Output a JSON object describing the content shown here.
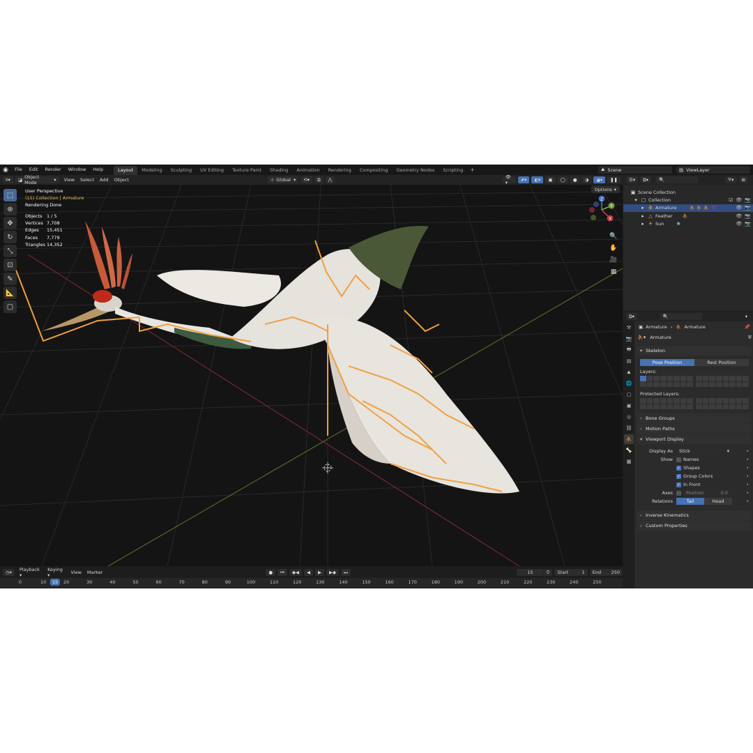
{
  "menu": {
    "items": [
      "File",
      "Edit",
      "Render",
      "Window",
      "Help"
    ],
    "workspaces": [
      "Layout",
      "Modeling",
      "Sculpting",
      "UV Editing",
      "Texture Paint",
      "Shading",
      "Animation",
      "Rendering",
      "Compositing",
      "Geometry Nodes",
      "Scripting"
    ],
    "active_workspace": "Layout",
    "scene": "Scene",
    "view_layer": "ViewLayer"
  },
  "viewport_header": {
    "mode": "Object Mode",
    "menus": [
      "View",
      "Select",
      "Add",
      "Object"
    ],
    "orientation": "Global",
    "options_label": "Options"
  },
  "overlay": {
    "view_name": "User Perspective",
    "collection_line": "(15) Collection | Armature",
    "status": "Rendering Done",
    "stats": [
      {
        "k": "Objects",
        "v": "1 / 5"
      },
      {
        "k": "Vertices",
        "v": "7,708"
      },
      {
        "k": "Edges",
        "v": "15,451"
      },
      {
        "k": "Faces",
        "v": "7,779"
      },
      {
        "k": "Triangles",
        "v": "14,352"
      }
    ],
    "gizmo_axes": {
      "x": "X",
      "y": "Y",
      "z": "Z"
    }
  },
  "timeline": {
    "menus": [
      "Playback",
      "Keying",
      "View",
      "Marker"
    ],
    "current_frame": "15",
    "start_label": "Start",
    "start": "1",
    "end_label": "End",
    "end": "250",
    "ticks": [
      "0",
      "10",
      "20",
      "30",
      "40",
      "50",
      "60",
      "70",
      "80",
      "90",
      "100",
      "110",
      "120",
      "130",
      "140",
      "150",
      "160",
      "170",
      "180",
      "190",
      "200",
      "210",
      "220",
      "230",
      "240",
      "250"
    ]
  },
  "outliner": {
    "root": "Scene Collection",
    "collection": "Collection",
    "items": [
      {
        "name": "Armature",
        "selected": true
      },
      {
        "name": "Feather",
        "selected": false
      },
      {
        "name": "Sun",
        "selected": false
      }
    ]
  },
  "properties": {
    "breadcrumb_object": "Armature",
    "breadcrumb_data": "Armature",
    "data_name": "Armature",
    "skeleton": {
      "title": "Skeleton",
      "pose_position": "Pose Position",
      "rest_position": "Rest Position",
      "layers_label": "Layers:",
      "protected_label": "Protected Layers:"
    },
    "bone_groups": "Bone Groups",
    "motion_paths": "Motion Paths",
    "viewport_display": {
      "title": "Viewport Display",
      "display_as_label": "Display As",
      "display_as_value": "Stick",
      "show_label": "Show",
      "names": "Names",
      "shapes": "Shapes",
      "group_colors": "Group Colors",
      "in_front": "In Front",
      "axes_label": "Axes",
      "position_label": "Position",
      "position_value": "0.0",
      "relations_label": "Relations",
      "tail": "Tail",
      "head": "Head"
    },
    "inverse_kinematics": "Inverse Kinematics",
    "custom_properties": "Custom Properties"
  },
  "colors": {
    "accent": "#4772b3",
    "bone": "#f0a040",
    "x_axis": "#b03a48",
    "y_axis": "#6a8a30"
  }
}
